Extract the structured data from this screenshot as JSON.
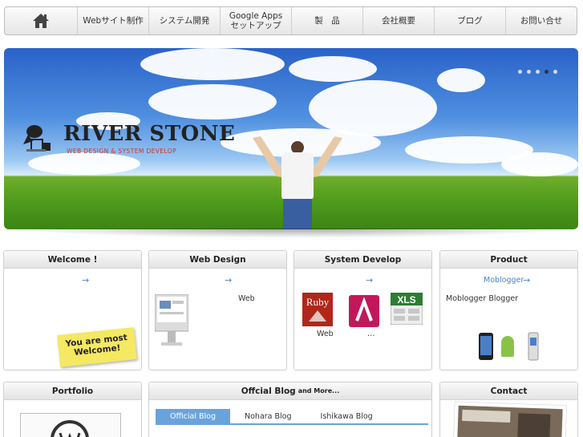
{
  "nav": {
    "items": [
      {
        "label": "Webサイト制作"
      },
      {
        "label": "システム開発"
      },
      {
        "label": "Google Apps\nセットアップ"
      },
      {
        "label": "製　品"
      },
      {
        "label": "会社概要"
      },
      {
        "label": "ブログ"
      },
      {
        "label": "お問い合せ"
      }
    ]
  },
  "hero": {
    "logo_title": "RIVER STONE",
    "logo_sub": "WEB DESIGN & SYSTEM DEVELOP",
    "slides": 5,
    "active_slide": 4
  },
  "panels": {
    "welcome": {
      "title": "Welcome !",
      "arrow": "→",
      "sticky": "You are most Welcome!"
    },
    "webdesign": {
      "title": "Web Design",
      "arrow": "→",
      "text": "Web"
    },
    "system": {
      "title": "System Develop",
      "arrow": "→",
      "text": "Web",
      "ellipsis": "…"
    },
    "product": {
      "title": "Product",
      "link": "Moblogger",
      "arrow": "→",
      "text": "Moblogger  Blogger"
    },
    "portfolio": {
      "title": "Portfolio"
    },
    "blog": {
      "title": "Offcial Blog",
      "title_small": "and More...",
      "tabs": [
        {
          "label": "Official Blog"
        },
        {
          "label": "Nohara Blog"
        },
        {
          "label": "Ishikawa Blog"
        }
      ]
    },
    "contact": {
      "title": "Contact"
    }
  },
  "colors": {
    "accent": "#6aa3dc",
    "arrow": "#4a86c5",
    "logo_sub": "#c8362b"
  }
}
